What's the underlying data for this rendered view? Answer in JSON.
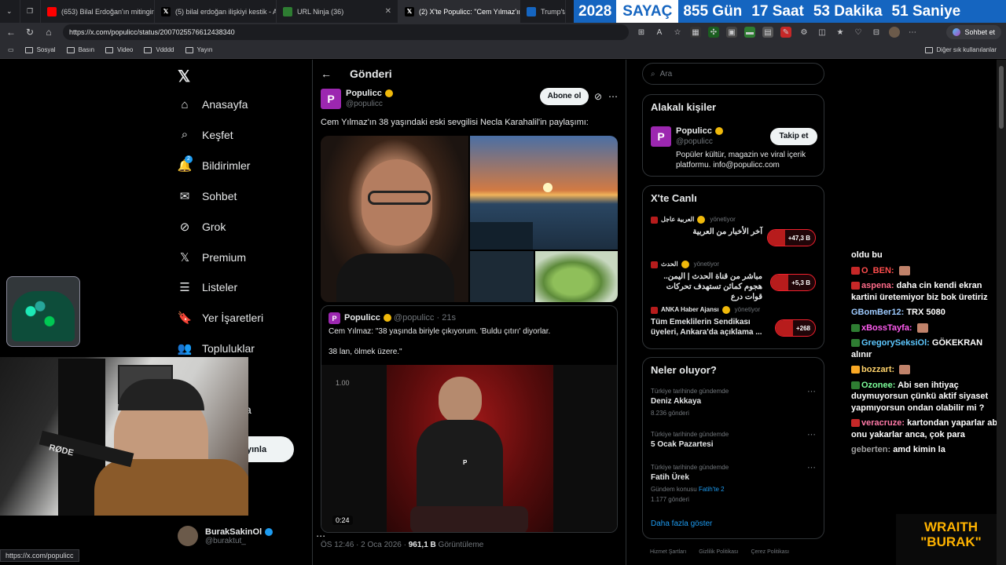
{
  "browser": {
    "tabs": [
      {
        "title": "(653) Bilal Erdoğan'ın mitingine k",
        "favicon": "youtube-icon",
        "color": "#ff0000"
      },
      {
        "title": "(5) bilal erdoğan ilişkiyi kestik - A",
        "favicon": "x-icon",
        "color": "#000000"
      },
      {
        "title": "URL Ninja (36)",
        "favicon": "url-ninja-icon",
        "color": "#2e7d32"
      },
      {
        "title": "(2) X'te Populicc: \"Cem Yılmaz'ın",
        "favicon": "x-icon",
        "color": "#000000",
        "active": true
      },
      {
        "title": "Trump'tan",
        "favicon": "news-icon",
        "color": "#1565c0"
      }
    ],
    "countdown": {
      "year": "2028",
      "label": "SAYAÇ",
      "days": "855 Gün",
      "hours": "17 Saat",
      "minutes": "53 Dakika",
      "seconds": "51 Saniye"
    },
    "url": "https://x.com/populicc/status/2007025576612438340",
    "chat_button": "Sohbet et",
    "bookmarks": [
      "Sosyal",
      "Basın",
      "Video",
      "Vdddd",
      "Yayın"
    ],
    "other_bookmarks": "Diğer sık kullanılanlar",
    "status_url": "https://x.com/populicc"
  },
  "nav": {
    "items": [
      {
        "label": "Anasayfa",
        "icon": "home-icon",
        "glyph": "⌂"
      },
      {
        "label": "Keşfet",
        "icon": "search-icon",
        "glyph": "⌕"
      },
      {
        "label": "Bildirimler",
        "icon": "bell-icon",
        "glyph": "🔔"
      },
      {
        "label": "Sohbet",
        "icon": "mail-icon",
        "glyph": "✉"
      },
      {
        "label": "Grok",
        "icon": "grok-icon",
        "glyph": "⊘"
      },
      {
        "label": "Premium",
        "icon": "x-premium-icon",
        "glyph": "𝕏"
      },
      {
        "label": "Listeler",
        "icon": "list-icon",
        "glyph": "☰"
      },
      {
        "label": "Yer İşaretleri",
        "icon": "bookmark-icon",
        "glyph": "🔖"
      },
      {
        "label": "Topluluklar",
        "icon": "communities-icon",
        "glyph": "👥"
      }
    ],
    "notif_count": "2",
    "partial_label": "a",
    "publish_label": "yınla",
    "profile": {
      "name": "BurakSakinOl",
      "handle": "@buraktut_"
    }
  },
  "post": {
    "header": "Gönderi",
    "author": "Populicc",
    "handle": "@populicc",
    "follow_label": "Abone ol",
    "text": "Cem Yılmaz'ın 38 yaşındaki eski sevgilisi Necla Karahalil'in paylaşımı:",
    "quote": {
      "author": "Populicc",
      "handle": "@populicc",
      "time": "21s",
      "line1": "Cem Yılmaz:  \"38 yaşında biriyle çıkıyorum. 'Buldu çıtırı' diyorlar.",
      "line2": "38 lan, ölmek üzere.\"",
      "video_speed": "1.00",
      "video_time": "0:24"
    },
    "meta_time": "ÖS 12:46 · 2 Oca 2026 · ",
    "views": "961,1 B",
    "views_label": "Görüntüleme"
  },
  "sidebar": {
    "search_placeholder": "Ara",
    "related": {
      "title": "Alakalı kişiler",
      "name": "Populicc",
      "handle": "@populicc",
      "follow_label": "Takip et",
      "bio": "Popüler kültür, magazin ve viral içerik platformu. info@populicc.com"
    },
    "live": {
      "title": "X'te Canlı",
      "items": [
        {
          "source": "العربية عاجل",
          "role": "yönetiyor",
          "text": "آخر الأخبار من العربية",
          "count": "+47,3 B"
        },
        {
          "source": "الحدث",
          "role": "yönetiyor",
          "text": "مباشر من قناة الحدث | اليمن.. هجوم كمائن تستهدف تحركات قوات درع",
          "count": "+5,3 B"
        },
        {
          "source": "ANKA Haber Ajansı",
          "role": "yönetiyor",
          "text": "Tüm Emeklilerin Sendikası üyeleri, Ankara'da açıklama ...",
          "count": "+268"
        }
      ]
    },
    "trends": {
      "title": "Neler oluyor?",
      "items": [
        {
          "context": "Türkiye tarihinde gündemde",
          "name": "Deniz Akkaya",
          "count": "8.236 gönderi"
        },
        {
          "context": "Türkiye tarihinde gündemde",
          "name": "5 Ocak Pazartesi",
          "count": ""
        },
        {
          "context": "Türkiye tarihinde gündemde",
          "name": "Fatih Ürek",
          "sub": "Gündem konusu",
          "sub_link": "Fatih'te 2",
          "count": "1.177 gönderi"
        }
      ],
      "more": "Daha fazla göster"
    },
    "footer": [
      "Hizmet Şartları",
      "Gizlilik Politikası",
      "Çerez Politikası"
    ]
  },
  "chat": [
    {
      "user": "",
      "msg": "oldu bu",
      "color": "#ffffff"
    },
    {
      "user": "O_BEN:",
      "msg": "",
      "color": "#ff4d4d"
    },
    {
      "user": "aspena:",
      "msg": "daha cin kendi ekran kartini üretemiyor biz bok üretiriz",
      "color": "#ff6b8a"
    },
    {
      "user": "GBomBer12:",
      "msg": "TRX 5080",
      "color": "#9ecbff"
    },
    {
      "user": "xBossTayfa:",
      "msg": "",
      "color": "#ff5cf0"
    },
    {
      "user": "GregorySeksiOl:",
      "msg": "GÖKEKRAN alınır",
      "color": "#5ec8ff"
    },
    {
      "user": "bozzart:",
      "msg": "",
      "color": "#ffd36b"
    },
    {
      "user": "Ozonee:",
      "msg": "Abi sen ihtiyaç duymuyorsun çünkü aktif siyaset yapmıyorsun ondan olabilir mi ?",
      "color": "#7dff9b"
    },
    {
      "user": "veracruze:",
      "msg": "kartondan yaparlar abi onu yakarlar anca, çok para",
      "color": "#ff7aa8"
    },
    {
      "user": "geberten:",
      "msg": "amd kimin la",
      "color": "#a0a0a0"
    }
  ],
  "overlay": {
    "line1": "WRAITH",
    "line2": "\"BURAK\""
  },
  "webcam": {
    "mic_label": "RØDE"
  }
}
